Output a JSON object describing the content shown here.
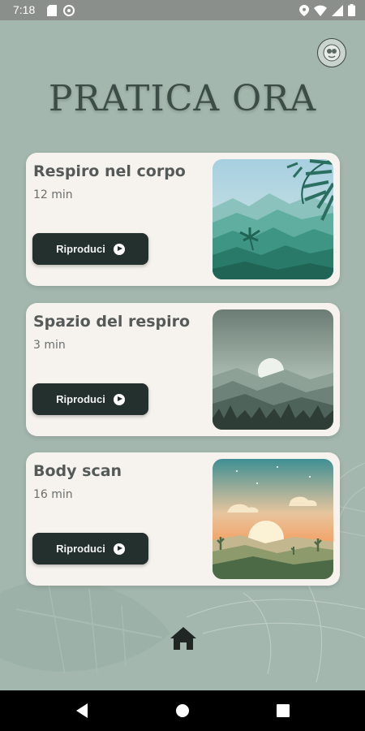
{
  "status_bar": {
    "time": "7:18"
  },
  "header": {
    "title": "PRATICA  ORA"
  },
  "practices": [
    {
      "title": "Respiro nel corpo",
      "duration": "12 min",
      "play_label": "Riproduci"
    },
    {
      "title": "Spazio del respiro",
      "duration": "3 min",
      "play_label": "Riproduci"
    },
    {
      "title": "Body scan",
      "duration": "16 min",
      "play_label": "Riproduci"
    }
  ],
  "icons": {
    "profile": "avatar-icon",
    "play": "play-circle-icon",
    "home": "home-icon",
    "back": "back-triangle-icon",
    "recent": "square-icon"
  },
  "colors": {
    "background": "#a3b7ae",
    "card": "#f6f3ee",
    "button": "#24302d",
    "title": "#3c4d47"
  }
}
